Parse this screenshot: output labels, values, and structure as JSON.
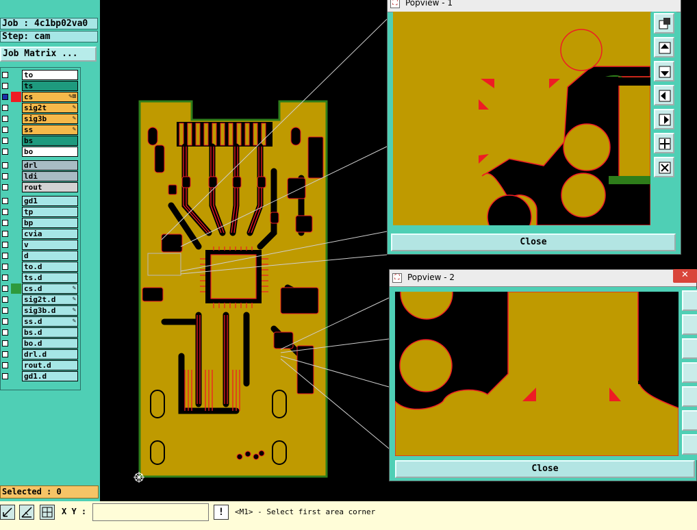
{
  "job": {
    "label": "Job : 4c1bp02va0",
    "step": "Step: cam",
    "matrix_button": "Job Matrix ..."
  },
  "layers": [
    {
      "name": "to",
      "color": "#ffffff",
      "swatch": "",
      "tag": ""
    },
    {
      "name": "ts",
      "color": "#1e9a7e",
      "swatch": "",
      "tag": ""
    },
    {
      "name": "cs",
      "color": "#f5b94a",
      "swatch": "#ee1c24",
      "tag": "✎⊞"
    },
    {
      "name": "sig2t",
      "color": "#f5b94a",
      "swatch": "",
      "tag": "✎"
    },
    {
      "name": "sig3b",
      "color": "#f5b94a",
      "swatch": "",
      "tag": "✎"
    },
    {
      "name": "ss",
      "color": "#f5b94a",
      "swatch": "",
      "tag": "✎"
    },
    {
      "name": "bs",
      "color": "#1e9a7e",
      "swatch": "",
      "tag": ""
    },
    {
      "name": "bo",
      "color": "#ffffff",
      "swatch": "",
      "tag": ""
    },
    {
      "name": "drl",
      "color": "#a8bcc4",
      "swatch": "",
      "tag": ""
    },
    {
      "name": "ldi",
      "color": "#a8bcc4",
      "swatch": "",
      "tag": ""
    },
    {
      "name": "rout",
      "color": "#d3d3d3",
      "swatch": "",
      "tag": ""
    },
    {
      "name": "gd1",
      "color": "#a6e6e6",
      "swatch": "",
      "tag": ""
    },
    {
      "name": "tp",
      "color": "#a6e6e6",
      "swatch": "",
      "tag": ""
    },
    {
      "name": "bp",
      "color": "#a6e6e6",
      "swatch": "",
      "tag": ""
    },
    {
      "name": "cvia",
      "color": "#a6e6e6",
      "swatch": "",
      "tag": ""
    },
    {
      "name": "v",
      "color": "#a6e6e6",
      "swatch": "",
      "tag": ""
    },
    {
      "name": "d",
      "color": "#a6e6e6",
      "swatch": "",
      "tag": ""
    },
    {
      "name": "to.d",
      "color": "#a6e6e6",
      "swatch": "",
      "tag": ""
    },
    {
      "name": "ts.d",
      "color": "#a6e6e6",
      "swatch": "",
      "tag": ""
    },
    {
      "name": "cs.d",
      "color": "#a6e6e6",
      "swatch": "#2e9a3c",
      "tag": "✎"
    },
    {
      "name": "sig2t.d",
      "color": "#a6e6e6",
      "swatch": "",
      "tag": "✎"
    },
    {
      "name": "sig3b.d",
      "color": "#a6e6e6",
      "swatch": "",
      "tag": "✎"
    },
    {
      "name": "ss.d",
      "color": "#a6e6e6",
      "swatch": "",
      "tag": "✎"
    },
    {
      "name": "bs.d",
      "color": "#a6e6e6",
      "swatch": "",
      "tag": ""
    },
    {
      "name": "bo.d",
      "color": "#a6e6e6",
      "swatch": "",
      "tag": ""
    },
    {
      "name": "drl.d",
      "color": "#a6e6e6",
      "swatch": "",
      "tag": ""
    },
    {
      "name": "rout.d",
      "color": "#a6e6e6",
      "swatch": "",
      "tag": ""
    },
    {
      "name": "gd1.d",
      "color": "#a6e6e6",
      "swatch": "",
      "tag": ""
    }
  ],
  "selected": "Selected : 0",
  "bottom": {
    "xy_label": "X Y :",
    "xy_value": "",
    "warn": "!",
    "status": "<M1> - Select first area corner"
  },
  "popview1": {
    "title": "Popview - 1",
    "close": "Close"
  },
  "popview2": {
    "title": "Popview - 2",
    "close": "Close",
    "close_x": "✕"
  },
  "colors": {
    "copper": "#bf9a00",
    "outline": "#ee1c24",
    "panel": "#4fcfb5",
    "board_edge": "#2e7d1a"
  }
}
